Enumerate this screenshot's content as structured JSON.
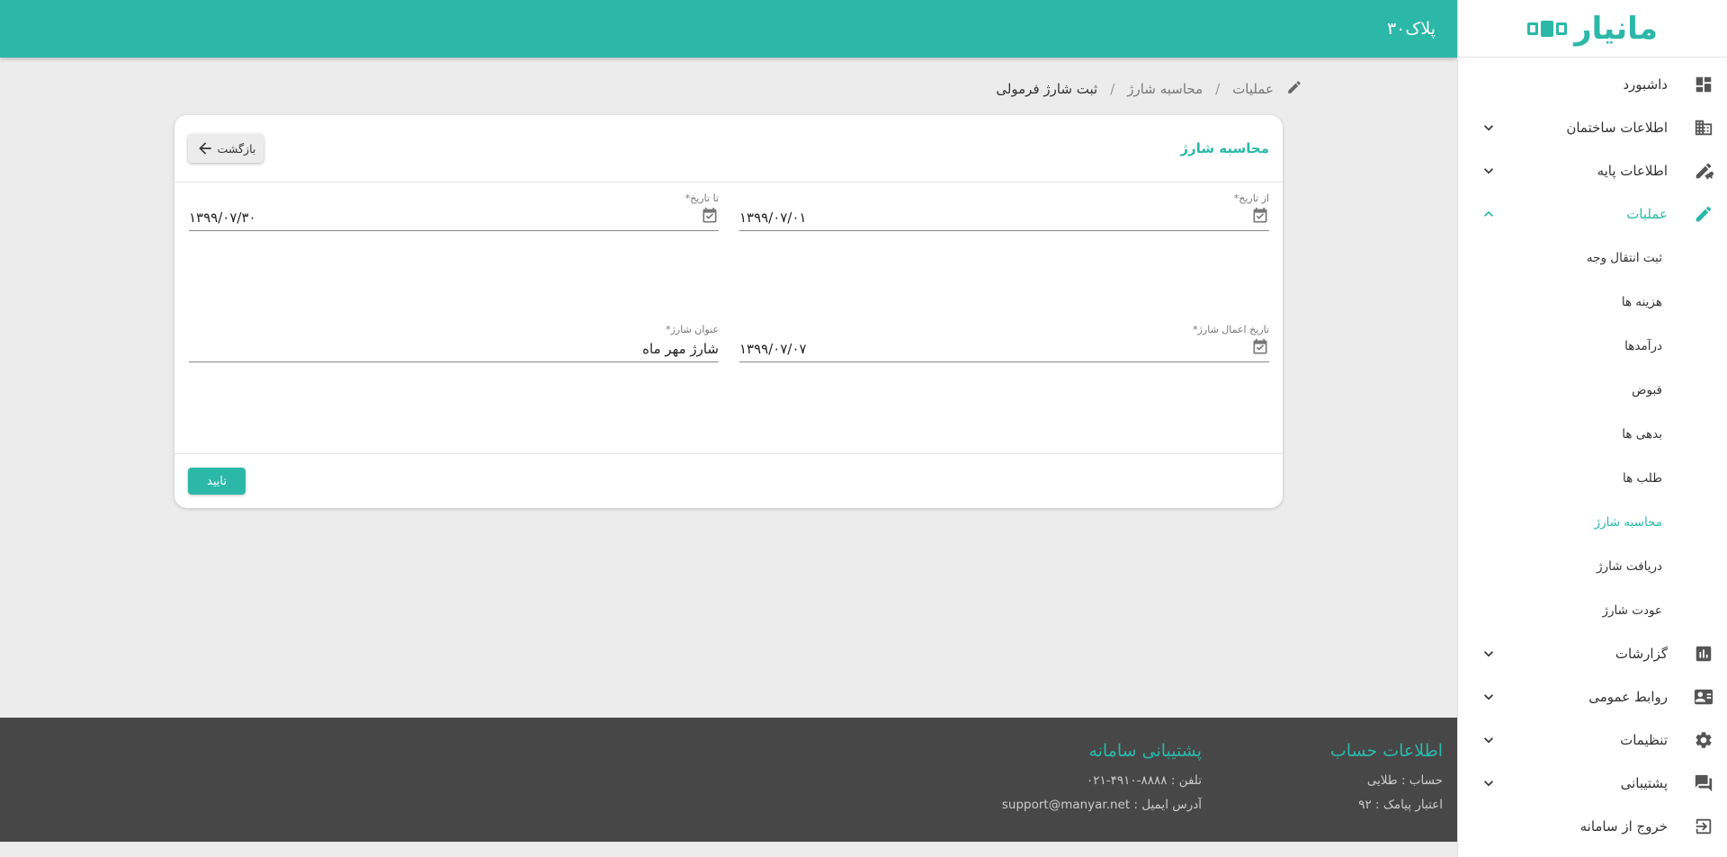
{
  "brand": {
    "logo_text": "مانیار"
  },
  "topbar": {
    "title": "پلاک۳۰"
  },
  "sidebar": {
    "items": [
      {
        "label": "داشبورد",
        "icon": "dashboard-icon"
      },
      {
        "label": "اطلاعات ساختمان",
        "icon": "building-icon"
      },
      {
        "label": "اطلاعات پایه",
        "icon": "settings-pen-icon"
      },
      {
        "label": "عملیات",
        "icon": "pencil-icon"
      },
      {
        "label": "گزارشات",
        "icon": "chart-icon"
      },
      {
        "label": "روابط عمومی",
        "icon": "contact-card-icon"
      },
      {
        "label": "تنظیمات",
        "icon": "gear-icon"
      },
      {
        "label": "پشتیبانی",
        "icon": "chat-icon"
      },
      {
        "label": "خروج از سامانه",
        "icon": "logout-icon"
      }
    ],
    "sub_items": [
      "ثبت انتقال وجه",
      "هزینه ها",
      "درآمدها",
      "قبوض",
      "بدهی ها",
      "طلب ها",
      "محاسبه شارژ",
      "دریافت شارژ",
      "عودت شارژ"
    ]
  },
  "breadcrumb": {
    "first": "عملیات",
    "second": "محاسبه شارژ",
    "current": "ثبت شارژ فرمولی",
    "separator": "/"
  },
  "card": {
    "title": "محاسبه شارژ",
    "back_label": "بازگشت",
    "confirm_label": "تایید",
    "fields": {
      "from_date": {
        "label": "از تاریخ*",
        "value": "۱۳۹۹/۰۷/۰۱"
      },
      "to_date": {
        "label": "تا تاریخ*",
        "value": "۱۳۹۹/۰۷/۳۰"
      },
      "apply_date": {
        "label": "تاریخ اعمال شارژ*",
        "value": "۱۳۹۹/۰۷/۰۷"
      },
      "charge_title": {
        "label": "عنوان شارژ*",
        "value": "شارژ مهر ماه"
      }
    }
  },
  "footer": {
    "account": {
      "heading": "اطلاعات حساب",
      "line1": "حساب : طلایی",
      "line2": "اعتبار پیامک : ۹۲"
    },
    "support": {
      "heading": "پشتیبانی سامانه",
      "line1": "تلفن : ۸۸۸۸-۴۹۱۰-۰۲۱",
      "line2": "آدرس ایمیل : support@manyar.net"
    }
  },
  "colors": {
    "accent": "#2bb8a8",
    "footer_bg": "#474747",
    "page_bg": "#ececec"
  }
}
